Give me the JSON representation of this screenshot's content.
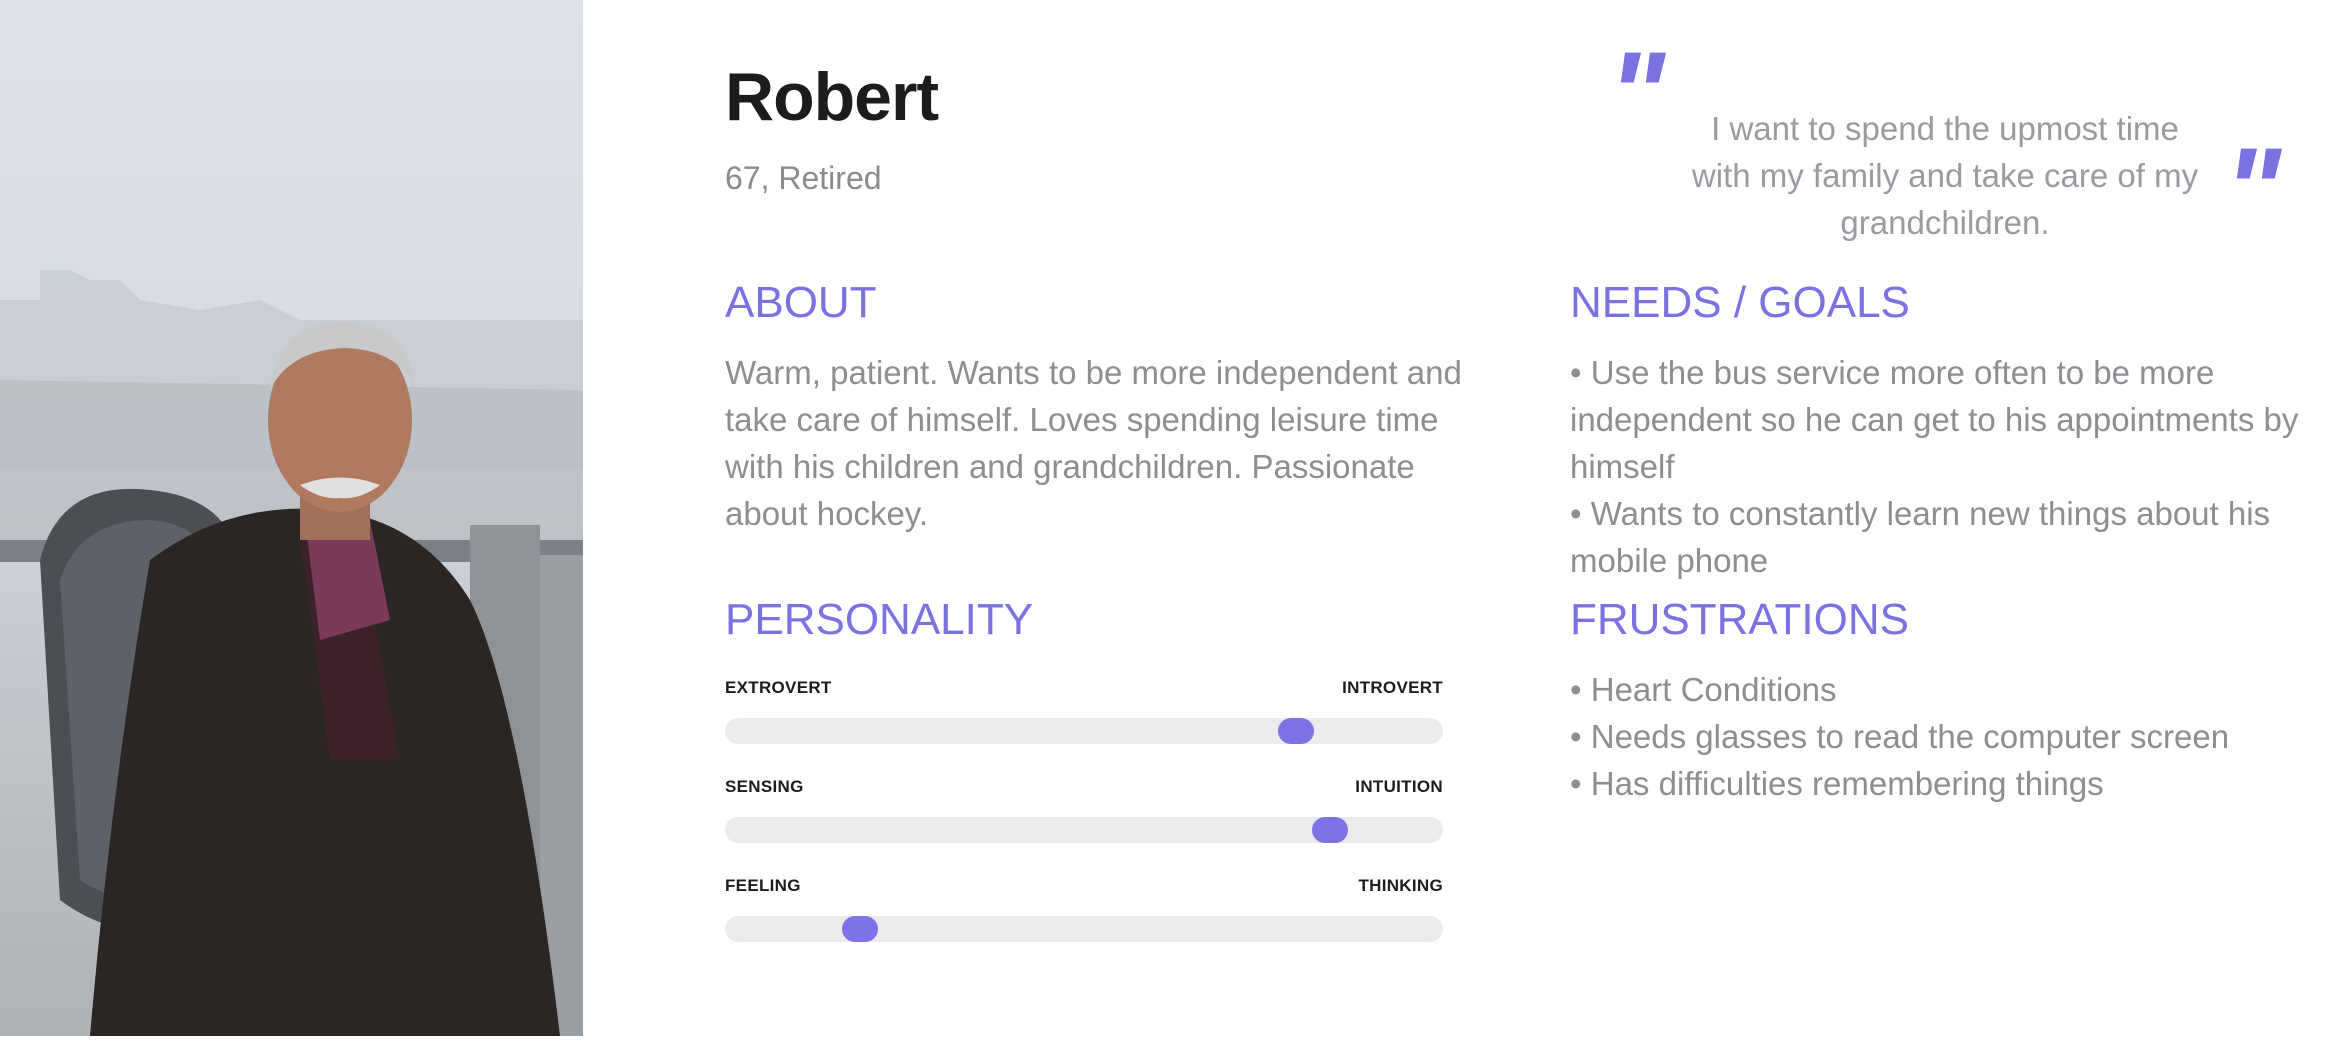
{
  "persona": {
    "name": "Robert",
    "age": "67,",
    "occupation": "Retired"
  },
  "quote": {
    "text": "I want to spend the upmost time with my family and take care of my grandchildren."
  },
  "about": {
    "heading": "ABOUT",
    "text": "Warm, patient. Wants to be more independent and take care of himself. Loves spending leisure time with his children and grandchildren. Passionate about hockey."
  },
  "needs": {
    "heading": "NEEDS / GOALS",
    "items": [
      "Use the bus service more often to be more independent so he can get to his appointments by himself",
      "Wants to constantly learn new things about his mobile phone"
    ]
  },
  "personality": {
    "heading": "PERSONALITY",
    "scales": [
      {
        "left": "EXTROVERT",
        "right": "INTROVERT",
        "value": 0.795
      },
      {
        "left": "SENSING",
        "right": "INTUITION",
        "value": 0.843
      },
      {
        "left": "FEELING",
        "right": "THINKING",
        "value": 0.188
      }
    ]
  },
  "frustrations": {
    "heading": "FRUSTRATIONS",
    "items": [
      "Heart Conditions",
      "Needs glasses to read the computer screen",
      "Has difficulties remembering things"
    ]
  },
  "colors": {
    "accent": "#7b72e2",
    "knob": "#7d73e6",
    "track": "#ebebed",
    "body_text": "#8d8d92"
  }
}
